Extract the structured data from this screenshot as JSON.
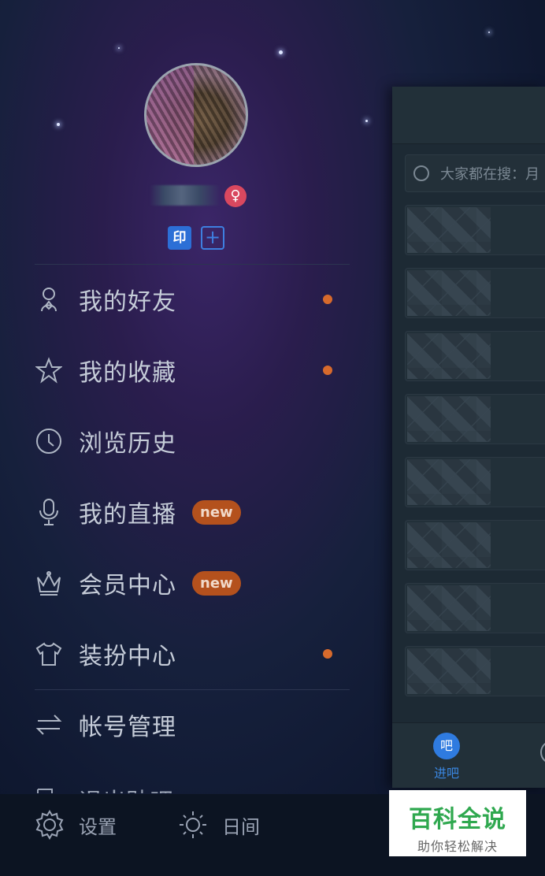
{
  "main": {
    "search_placeholder": "大家都在搜：月",
    "tabs": [
      {
        "icon_label": "吧",
        "label": "进吧"
      }
    ]
  },
  "drawer": {
    "gender_symbol": "♀",
    "badges": {
      "yin": "印",
      "plus": "+"
    },
    "menu": [
      {
        "label": "我的好友",
        "icon": "friends-icon",
        "dot": true
      },
      {
        "label": "我的收藏",
        "icon": "star-icon",
        "dot": true
      },
      {
        "label": "浏览历史",
        "icon": "clock-icon",
        "dot": false
      },
      {
        "label": "我的直播",
        "icon": "microphone-icon",
        "tag": "new"
      },
      {
        "label": "会员中心",
        "icon": "crown-icon",
        "tag": "new"
      },
      {
        "label": "装扮中心",
        "icon": "tshirt-icon",
        "dot": true
      },
      {
        "label": "帐号管理",
        "icon": "swap-icon"
      },
      {
        "label": "退出贴吧",
        "icon": "exit-icon"
      }
    ],
    "bottom": {
      "settings": "设置",
      "day_mode": "日间"
    }
  },
  "watermark": {
    "title": "百科全说",
    "subtitle": "助你轻松解决"
  },
  "colors": {
    "accent_blue": "#2f7be0",
    "dot_orange": "#d76a2c",
    "new_tag": "#b4511d",
    "gender_pink": "#d9485f"
  }
}
